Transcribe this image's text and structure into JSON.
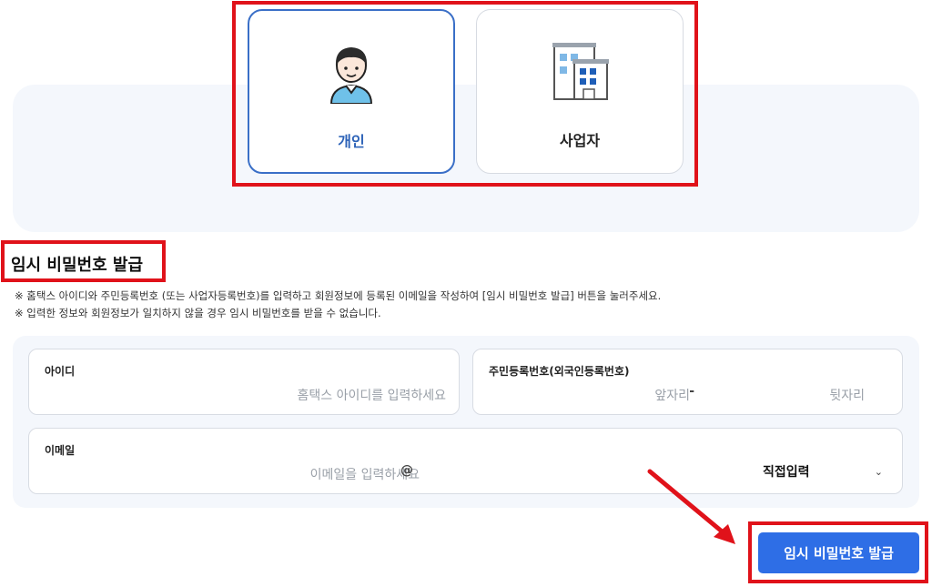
{
  "user_type": {
    "personal_label": "개인",
    "business_label": "사업자",
    "selected": "personal",
    "accent_color": "#2d63b8"
  },
  "section": {
    "title": "임시 비밀번호 발급",
    "notices": [
      "※ 홈택스 아이디와 주민등록번호 (또는 사업자등록번호)를 입력하고 회원정보에 등록된 이메일을 작성하여 [임시 비밀번호 발급] 버튼을 눌러주세요.",
      "※ 입력한 정보와 회원정보가 일치하지 않을 경우 임시 비밀번호를 받을 수 없습니다."
    ]
  },
  "form": {
    "id_label": "아이디",
    "id_placeholder": "홈택스 아이디를 입력하세요",
    "rrn_label": "주민등록번호(외국인등록번호)",
    "rrn_front_placeholder": "앞자리",
    "rrn_separator": "-",
    "rrn_back_placeholder": "뒷자리",
    "email_label": "이메일",
    "email_local_placeholder": "이메일을 입력하세요",
    "email_at": "@",
    "email_domain_selected": "직접입력"
  },
  "submit_label": "임시 비밀번호 발급",
  "colors": {
    "highlight": "#e0121a",
    "button": "#2e6ee6",
    "panel_bg": "#f4f7fc"
  }
}
